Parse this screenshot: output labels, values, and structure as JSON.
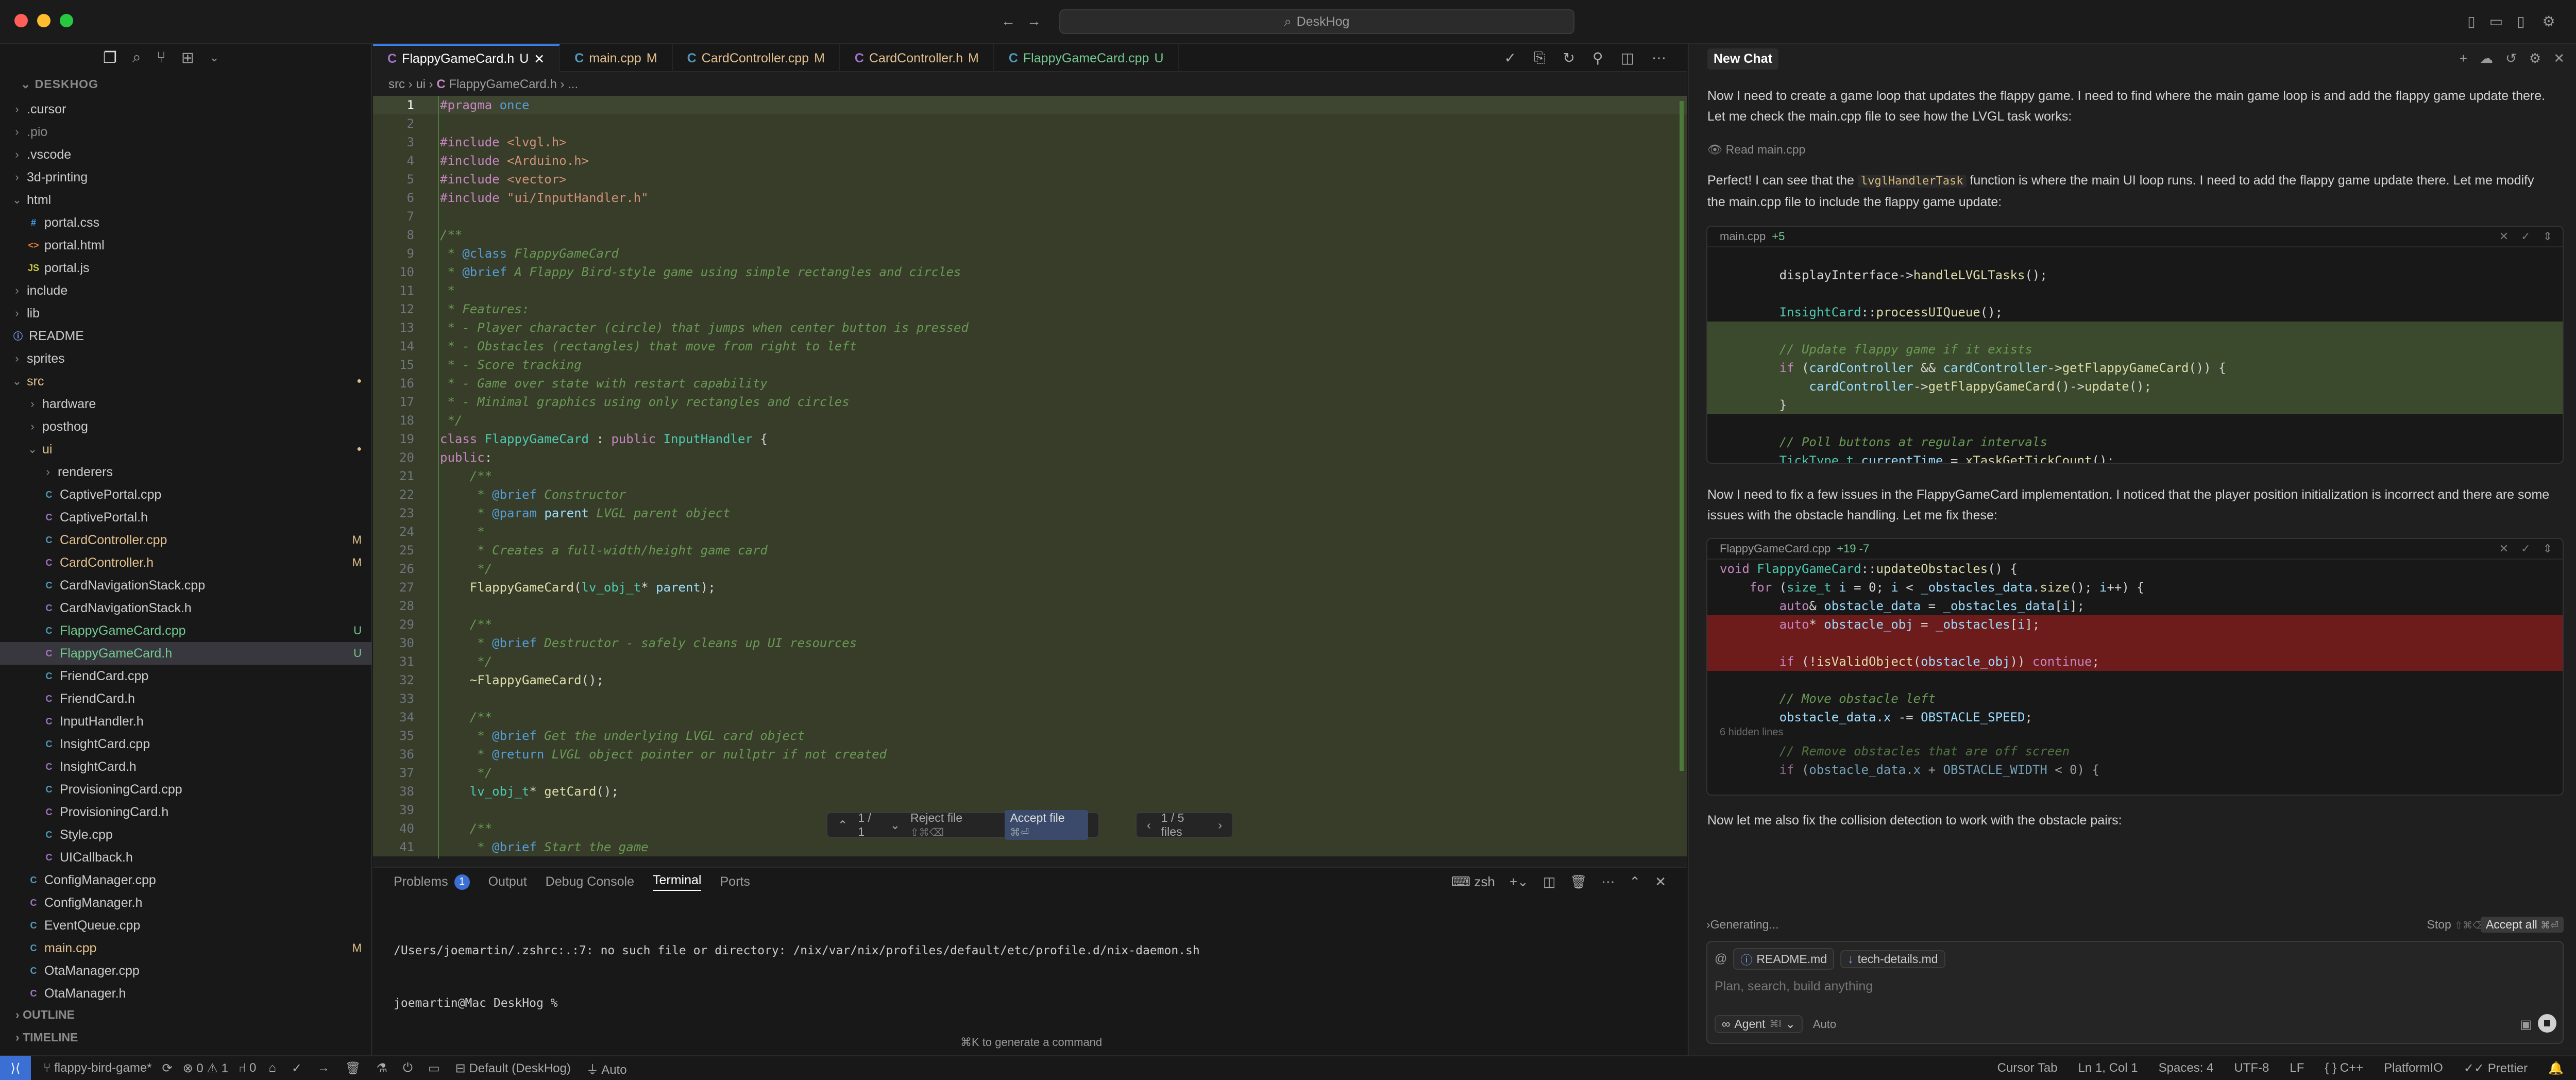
{
  "titlebar": {
    "title": "DeskHog"
  },
  "sidebar": {
    "project": "DESKHOG",
    "tree": [
      {
        "label": ".cursor",
        "kind": "folder",
        "depth": 0,
        "open": false
      },
      {
        "label": ".pio",
        "kind": "folder",
        "depth": 0,
        "open": false,
        "dim": true
      },
      {
        "label": ".vscode",
        "kind": "folder",
        "depth": 0,
        "open": false
      },
      {
        "label": "3d-printing",
        "kind": "folder",
        "depth": 0,
        "open": false
      },
      {
        "label": "html",
        "kind": "folder",
        "depth": 0,
        "open": true
      },
      {
        "label": "portal.css",
        "kind": "css",
        "depth": 1
      },
      {
        "label": "portal.html",
        "kind": "html",
        "depth": 1
      },
      {
        "label": "portal.js",
        "kind": "js",
        "depth": 1
      },
      {
        "label": "include",
        "kind": "folder",
        "depth": 0,
        "open": false
      },
      {
        "label": "lib",
        "kind": "folder",
        "depth": 0,
        "open": false
      },
      {
        "label": "README",
        "kind": "info",
        "depth": 0
      },
      {
        "label": "sprites",
        "kind": "folder",
        "depth": 0,
        "open": false
      },
      {
        "label": "src",
        "kind": "folder",
        "depth": 0,
        "open": true,
        "color": "#e2c08d",
        "dot": true
      },
      {
        "label": "hardware",
        "kind": "folder",
        "depth": 1,
        "open": false
      },
      {
        "label": "posthog",
        "kind": "folder",
        "depth": 1,
        "open": false
      },
      {
        "label": "ui",
        "kind": "folder",
        "depth": 1,
        "open": true,
        "color": "#e2c08d",
        "dot": true
      },
      {
        "label": "renderers",
        "kind": "folder",
        "depth": 2,
        "open": false
      },
      {
        "label": "CaptivePortal.cpp",
        "kind": "cpp",
        "depth": 2
      },
      {
        "label": "CaptivePortal.h",
        "kind": "h",
        "depth": 2
      },
      {
        "label": "CardController.cpp",
        "kind": "cpp",
        "depth": 2,
        "color": "#e2c08d",
        "badge": "M"
      },
      {
        "label": "CardController.h",
        "kind": "h",
        "depth": 2,
        "color": "#e2c08d",
        "badge": "M"
      },
      {
        "label": "CardNavigationStack.cpp",
        "kind": "cpp",
        "depth": 2
      },
      {
        "label": "CardNavigationStack.h",
        "kind": "h",
        "depth": 2
      },
      {
        "label": "FlappyGameCard.cpp",
        "kind": "cpp",
        "depth": 2,
        "color": "#73c991",
        "badge": "U"
      },
      {
        "label": "FlappyGameCard.h",
        "kind": "h",
        "depth": 2,
        "color": "#73c991",
        "badge": "U",
        "selected": true
      },
      {
        "label": "FriendCard.cpp",
        "kind": "cpp",
        "depth": 2
      },
      {
        "label": "FriendCard.h",
        "kind": "h",
        "depth": 2
      },
      {
        "label": "InputHandler.h",
        "kind": "h",
        "depth": 2
      },
      {
        "label": "InsightCard.cpp",
        "kind": "cpp",
        "depth": 2
      },
      {
        "label": "InsightCard.h",
        "kind": "h",
        "depth": 2
      },
      {
        "label": "ProvisioningCard.cpp",
        "kind": "cpp",
        "depth": 2
      },
      {
        "label": "ProvisioningCard.h",
        "kind": "h",
        "depth": 2
      },
      {
        "label": "Style.cpp",
        "kind": "cpp",
        "depth": 2
      },
      {
        "label": "UICallback.h",
        "kind": "h",
        "depth": 2
      },
      {
        "label": "ConfigManager.cpp",
        "kind": "cpp",
        "depth": 1
      },
      {
        "label": "ConfigManager.h",
        "kind": "h",
        "depth": 1
      },
      {
        "label": "EventQueue.cpp",
        "kind": "cpp",
        "depth": 1
      },
      {
        "label": "main.cpp",
        "kind": "cpp",
        "depth": 1,
        "color": "#e2c08d",
        "badge": "M"
      },
      {
        "label": "OtaManager.cpp",
        "kind": "cpp",
        "depth": 1
      },
      {
        "label": "OtaManager.h",
        "kind": "h",
        "depth": 1
      }
    ],
    "outline": "OUTLINE",
    "timeline": "TIMELINE"
  },
  "editor": {
    "tabs": [
      {
        "label": "FlappyGameCard.h",
        "status": "U",
        "active": true,
        "color": "#ffffff"
      },
      {
        "label": "main.cpp",
        "status": "M",
        "active": false,
        "color": "#e2c08d"
      },
      {
        "label": "CardController.cpp",
        "status": "M",
        "active": false,
        "color": "#e2c08d"
      },
      {
        "label": "CardController.h",
        "status": "M",
        "active": false,
        "color": "#e2c08d"
      },
      {
        "label": "FlappyGameCard.cpp",
        "status": "U",
        "active": false,
        "color": "#73c991"
      }
    ],
    "breadcrumb": [
      "src",
      "ui",
      "FlappyGameCard.h",
      "..."
    ],
    "review_bar": {
      "counter": "1 / 1",
      "reject": "Reject file",
      "reject_kbd": "⇧⌘⌫",
      "accept": "Accept file",
      "accept_kbd": "⌘⏎",
      "files": "1 / 5 files"
    }
  },
  "code_lines": [
    {
      "n": "1",
      "html": "<span class=\"kw\">#pragma</span> <span class=\"tag\">once</span>"
    },
    {
      "n": "2",
      "html": ""
    },
    {
      "n": "3",
      "html": "<span class=\"kw\">#include</span> <span class=\"str\">&lt;lvgl.h&gt;</span>"
    },
    {
      "n": "4",
      "html": "<span class=\"kw\">#include</span> <span class=\"str\">&lt;Arduino.h&gt;</span>"
    },
    {
      "n": "5",
      "html": "<span class=\"kw\">#include</span> <span class=\"str\">&lt;vector&gt;</span>"
    },
    {
      "n": "6",
      "html": "<span class=\"kw\">#include</span> <span class=\"str\">\"ui/InputHandler.h\"</span>"
    },
    {
      "n": "7",
      "html": ""
    },
    {
      "n": "8",
      "html": "<span class=\"cm\">/**</span>"
    },
    {
      "n": "9",
      "html": "<span class=\"cm\"> * </span><span class=\"tag\">@class</span><span class=\"cm\"> FlappyGameCard</span>"
    },
    {
      "n": "10",
      "html": "<span class=\"cm\"> * </span><span class=\"tag\">@brief</span><span class=\"cm\"> A Flappy Bird-style game using simple rectangles and circles</span>"
    },
    {
      "n": "11",
      "html": "<span class=\"cm\"> *</span>"
    },
    {
      "n": "12",
      "html": "<span class=\"cm\"> * Features:</span>"
    },
    {
      "n": "13",
      "html": "<span class=\"cm\"> * - Player character (circle) that jumps when center button is pressed</span>"
    },
    {
      "n": "14",
      "html": "<span class=\"cm\"> * - Obstacles (rectangles) that move from right to left</span>"
    },
    {
      "n": "15",
      "html": "<span class=\"cm\"> * - Score tracking</span>"
    },
    {
      "n": "16",
      "html": "<span class=\"cm\"> * - Game over state with restart capability</span>"
    },
    {
      "n": "17",
      "html": "<span class=\"cm\"> * - Minimal graphics using only rectangles and circles</span>"
    },
    {
      "n": "18",
      "html": "<span class=\"cm\"> */</span>"
    },
    {
      "n": "19",
      "html": "<span class=\"kw\">class</span> <span class=\"ty\">FlappyGameCard</span> <span class=\"pl\">:</span> <span class=\"kw\">public</span> <span class=\"ty\">InputHandler</span> <span class=\"pl\">{</span>"
    },
    {
      "n": "20",
      "html": "<span class=\"kw\">public</span><span class=\"pl\">:</span>"
    },
    {
      "n": "21",
      "html": "<span class=\"cm\">    /**</span>"
    },
    {
      "n": "22",
      "html": "<span class=\"cm\">     * </span><span class=\"tag\">@brief</span><span class=\"cm\"> Constructor</span>"
    },
    {
      "n": "23",
      "html": "<span class=\"cm\">     * </span><span class=\"tag\">@param</span> <span class=\"var\">parent</span><span class=\"cm\"> LVGL parent object</span>"
    },
    {
      "n": "24",
      "html": "<span class=\"cm\">     *</span>"
    },
    {
      "n": "25",
      "html": "<span class=\"cm\">     * Creates a full-width/height game card</span>"
    },
    {
      "n": "26",
      "html": "<span class=\"cm\">     */</span>"
    },
    {
      "n": "27",
      "html": "    <span class=\"fn\">FlappyGameCard</span><span class=\"pl\">(</span><span class=\"ty\">lv_obj_t</span><span class=\"pl\">*</span> <span class=\"var\">parent</span><span class=\"pl\">);</span>"
    },
    {
      "n": "28",
      "html": ""
    },
    {
      "n": "29",
      "html": "<span class=\"cm\">    /**</span>"
    },
    {
      "n": "30",
      "html": "<span class=\"cm\">     * </span><span class=\"tag\">@brief</span><span class=\"cm\"> Destructor - safely cleans up UI resources</span>"
    },
    {
      "n": "31",
      "html": "<span class=\"cm\">     */</span>"
    },
    {
      "n": "32",
      "html": "    <span class=\"fn\">~FlappyGameCard</span><span class=\"pl\">();</span>"
    },
    {
      "n": "33",
      "html": ""
    },
    {
      "n": "34",
      "html": "<span class=\"cm\">    /**</span>"
    },
    {
      "n": "35",
      "html": "<span class=\"cm\">     * </span><span class=\"tag\">@brief</span><span class=\"cm\"> Get the underlying LVGL card object</span>"
    },
    {
      "n": "36",
      "html": "<span class=\"cm\">     * </span><span class=\"tag\">@return</span><span class=\"cm\"> LVGL object pointer or nullptr if not created</span>"
    },
    {
      "n": "37",
      "html": "<span class=\"cm\">     */</span>"
    },
    {
      "n": "38",
      "html": "    <span class=\"ty\">lv_obj_t</span><span class=\"pl\">*</span> <span class=\"fn\">getCard</span><span class=\"pl\">();</span>"
    },
    {
      "n": "39",
      "html": ""
    },
    {
      "n": "40",
      "html": "<span class=\"cm\">    /**</span>"
    },
    {
      "n": "41",
      "html": "<span class=\"cm\">     * </span><span class=\"tag\">@brief</span><span class=\"cm\"> Start the game</span>"
    }
  ],
  "panel": {
    "tabs": [
      "Problems",
      "Output",
      "Debug Console",
      "Terminal",
      "Ports"
    ],
    "problems_count": "1",
    "active_tab": "Terminal",
    "shell": "zsh",
    "terminal_lines": [
      "/Users/joemartin/.zshrc:.:7: no such file or directory: /nix/var/nix/profiles/default/etc/profile.d/nix-daemon.sh",
      "joemartin@Mac DeskHog %"
    ],
    "hint": "⌘K to generate a command"
  },
  "chat": {
    "tab": "New Chat",
    "msg1": "Now I need to create a game loop that updates the flappy game. I need to find where the main game loop is and add the flappy game update there. Let me check the main.cpp file to see how the LVGL task works:",
    "read_label": "Read main.cpp",
    "msg2_a": "Perfect! I can see that the",
    "msg2_code": "lvglHandlerTask",
    "msg2_b": "function is where the main UI loop runs. I need to add the flappy game update there. Let me modify the main.cpp file to include the flappy game update:",
    "block1": {
      "file": "main.cpp",
      "delta": "+5",
      "lines": [
        {
          "t": "",
          "bg": ""
        },
        {
          "t": "        displayInterface-><span class=\"fn\">handleLVGLTasks</span>();",
          "bg": ""
        },
        {
          "t": "",
          "bg": ""
        },
        {
          "t": "        <span class=\"ty\">InsightCard</span>::<span class=\"fn\">processUIQueue</span>();",
          "bg": ""
        },
        {
          "t": "",
          "bg": "green"
        },
        {
          "t": "        <span class=\"cm\">// Update flappy game if it exists</span>",
          "bg": "green"
        },
        {
          "t": "        <span class=\"kw\">if</span> (<span class=\"var\">cardController</span> &amp;&amp; <span class=\"var\">cardController</span>-><span class=\"fn\">getFlappyGameCard</span>()) {",
          "bg": "green"
        },
        {
          "t": "            <span class=\"var\">cardController</span>-><span class=\"fn\">getFlappyGameCard</span>()-><span class=\"fn\">update</span>();",
          "bg": "green"
        },
        {
          "t": "        }",
          "bg": "green"
        },
        {
          "t": "",
          "bg": ""
        },
        {
          "t": "        <span class=\"cm\">// Poll buttons at regular intervals</span>",
          "bg": ""
        },
        {
          "t": "        <span class=\"ty\">TickType_t</span> <span class=\"var\">currentTime</span> = <span class=\"fn\">xTaskGetTickCount</span>();",
          "bg": ""
        }
      ]
    },
    "msg3": "Now I need to fix a few issues in the FlappyGameCard implementation. I noticed that the player position initialization is incorrect and there are some issues with the obstacle handling. Let me fix these:",
    "block2": {
      "file": "FlappyGameCard.cpp",
      "delta": "+19 -7",
      "hidden": "6 hidden lines",
      "lines": [
        {
          "t": "<span class=\"kw\">void</span> <span class=\"ty\">FlappyGameCard</span>::<span class=\"fn\">updateObstacles</span>() {",
          "bg": ""
        },
        {
          "t": "    <span class=\"kw\">for</span> (<span class=\"ty\">size_t</span> <span class=\"var\">i</span> = 0; <span class=\"var\">i</span> &lt; <span class=\"var\">_obstacles_data</span>.<span class=\"fn\">size</span>(); <span class=\"var\">i</span>++) {",
          "bg": ""
        },
        {
          "t": "        <span class=\"kw\">auto</span>&amp; <span class=\"var\">obstacle_data</span> = <span class=\"var\">_obstacles_data</span>[<span class=\"var\">i</span>];",
          "bg": ""
        },
        {
          "t": "        <span class=\"kw\">auto</span>* <span class=\"var\">obstacle_obj</span> = <span class=\"var\">_obstacles</span>[<span class=\"var\">i</span>];",
          "bg": "red"
        },
        {
          "t": "",
          "bg": "red"
        },
        {
          "t": "        <span class=\"kw\">if</span> (!<span class=\"fn\">isValidObject</span>(<span class=\"var\">obstacle_obj</span>)) <span class=\"kw\">continue</span>;",
          "bg": "red"
        },
        {
          "t": "",
          "bg": ""
        },
        {
          "t": "        <span class=\"cm\">// Move obstacle left</span>",
          "bg": ""
        },
        {
          "t": "        <span class=\"var\">obstacle_data</span>.<span class=\"var\">x</span> -= <span class=\"var\">OBSTACLE_SPEED</span>;",
          "bg": ""
        }
      ],
      "tail_lines": [
        {
          "t": "        <span class=\"cm\">// Remove obstacles that are off screen</span>",
          "bg": ""
        },
        {
          "t": "        <span class=\"kw\">if</span> (<span class=\"var\">obstacle_data</span>.<span class=\"var\">x</span> + <span class=\"var\">OBSTACLE_WIDTH</span> &lt; 0) {",
          "bg": ""
        }
      ]
    },
    "msg4": "Now let me also fix the collision detection to work with the obstacle pairs:",
    "generating": "Generating...",
    "stop": "Stop",
    "stop_kbd": "⇧⌘⌫",
    "accept_all": "Accept all",
    "accept_all_kbd": "⌘⏎",
    "context_chips": [
      "README.md",
      "tech-details.md"
    ],
    "input_placeholder": "Plan, search, build anything",
    "agent_label": "Agent",
    "agent_kbd": "⌘I",
    "auto_label": "Auto"
  },
  "statusbar": {
    "branch": "flappy-bird-game*",
    "errors": "0",
    "warnings": "1",
    "ports": "0",
    "env": "Default (DeskHog)",
    "auto": "Auto",
    "cursor_tab": "Cursor Tab",
    "position": "Ln 1, Col 1",
    "spaces": "Spaces: 4",
    "encoding": "UTF-8",
    "eol": "LF",
    "lang": "C++",
    "platform": "PlatformIO",
    "formatter": "Prettier"
  }
}
